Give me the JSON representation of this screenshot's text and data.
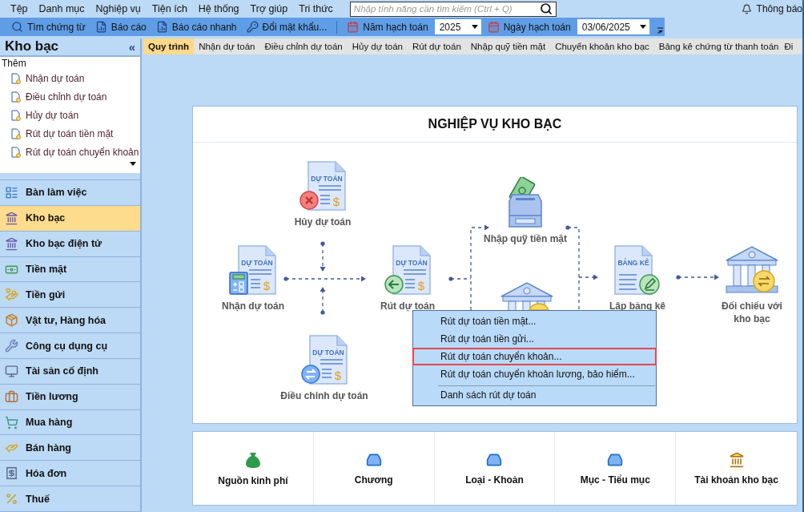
{
  "menu_bar": {
    "items": [
      "Tệp",
      "Danh mục",
      "Nghiệp vụ",
      "Tiện ích",
      "Hệ thống",
      "Trợ giúp",
      "Tri thức"
    ],
    "search": {
      "placeholder": "Nhập tính năng cần tìm kiếm (Ctrl + Q)"
    },
    "notifications": "Thông báo"
  },
  "toolbar": {
    "buttons": [
      "Tìm chứng từ",
      "Báo cáo",
      "Báo cáo nhanh",
      "Đổi mật khẩu..."
    ],
    "year_label": "Năm hạch toán",
    "year": "2025",
    "date_label": "Ngày hạch toán",
    "date": "03/06/2025"
  },
  "sidebar": {
    "title": "Kho bạc",
    "collapse": "«",
    "tasks_heading": "Thêm",
    "tasks": [
      "Nhận dự toán",
      "Điều chỉnh dự toán",
      "Hủy dự toán",
      "Rút dự toán tiền mặt",
      "Rút dự toán chuyển khoản"
    ],
    "nav": [
      {
        "label": "Bàn làm việc",
        "selected": false
      },
      {
        "label": "Kho bạc",
        "selected": true
      },
      {
        "label": "Kho bạc điện tử",
        "selected": false
      },
      {
        "label": "Tiền mặt",
        "selected": false
      },
      {
        "label": "Tiền gửi",
        "selected": false
      },
      {
        "label": "Vật tư, Hàng hóa",
        "selected": false
      },
      {
        "label": "Công cụ dụng cụ",
        "selected": false
      },
      {
        "label": "Tài sản cố định",
        "selected": false
      },
      {
        "label": "Tiền lương",
        "selected": false
      },
      {
        "label": "Mua hàng",
        "selected": false
      },
      {
        "label": "Bán hàng",
        "selected": false
      },
      {
        "label": "Hóa đơn",
        "selected": false
      },
      {
        "label": "Thuế",
        "selected": false
      }
    ]
  },
  "tabs": [
    {
      "label": "Quy trình",
      "selected": true
    },
    {
      "label": "Nhận dự toán",
      "selected": false
    },
    {
      "label": "Điều chỉnh dự toán",
      "selected": false
    },
    {
      "label": "Hủy dự toán",
      "selected": false
    },
    {
      "label": "Rút dự toán",
      "selected": false
    },
    {
      "label": "Nhập quỹ tiền mặt",
      "selected": false
    },
    {
      "label": "Chuyển khoản kho bạc",
      "selected": false
    },
    {
      "label": "Bảng kê chứng từ thanh toán",
      "selected": false
    },
    {
      "label": "Đi",
      "selected": false
    }
  ],
  "process": {
    "title": "NGHIỆP VỤ KHO BẠC",
    "nodes": [
      {
        "kind": "document",
        "heading": "DỰ TOÁN",
        "currency": "$",
        "badge": {
          "kind": "cancel"
        },
        "label": "Hủy dự toán"
      },
      {
        "kind": "document",
        "heading": "DỰ TOÁN",
        "currency": "$",
        "badge": {
          "kind": "calculator"
        },
        "label": "Nhận dự toán"
      },
      {
        "kind": "document",
        "heading": "DỰ TOÁN",
        "currency": "$",
        "badge": {
          "kind": "back"
        },
        "label": "Rút dự toán"
      },
      {
        "kind": "document",
        "heading": "DỰ TOÁN",
        "currency": "$",
        "badge": {
          "kind": "swap"
        },
        "label": "Điều chỉnh dự toán"
      },
      {
        "kind": "cash-box",
        "label": "Nhập quỹ tiền mặt"
      },
      {
        "kind": "bank",
        "badge": {
          "kind": "coin"
        }
      },
      {
        "kind": "document",
        "heading": "BẢNG KÊ",
        "badge": {
          "kind": "edit"
        },
        "label": "Lập bảng kê"
      },
      {
        "kind": "bank",
        "badge": {
          "kind": "swap-coin"
        },
        "label": "Đối chiếu với kho bạc"
      }
    ],
    "context_menu": {
      "items": [
        {
          "label": "Rút dự toán tiền mặt...",
          "selected": false,
          "separator_before": false
        },
        {
          "label": "Rút dự toán tiền gửi...",
          "selected": false,
          "separator_before": false
        },
        {
          "label": "Rút dự toán chuyển khoản...",
          "selected": true,
          "separator_before": false
        },
        {
          "label": "Rút dự toán chuyển khoản lương, bảo hiểm...",
          "selected": false,
          "separator_before": false
        },
        {
          "label": "Danh sách rút dự toán",
          "selected": false,
          "separator_before": true
        }
      ]
    }
  },
  "shortcuts": [
    "Nguồn kinh phí",
    "Chương",
    "Loại - Khoản",
    "Mục - Tiểu mục",
    "Tài khoản kho bạc"
  ]
}
